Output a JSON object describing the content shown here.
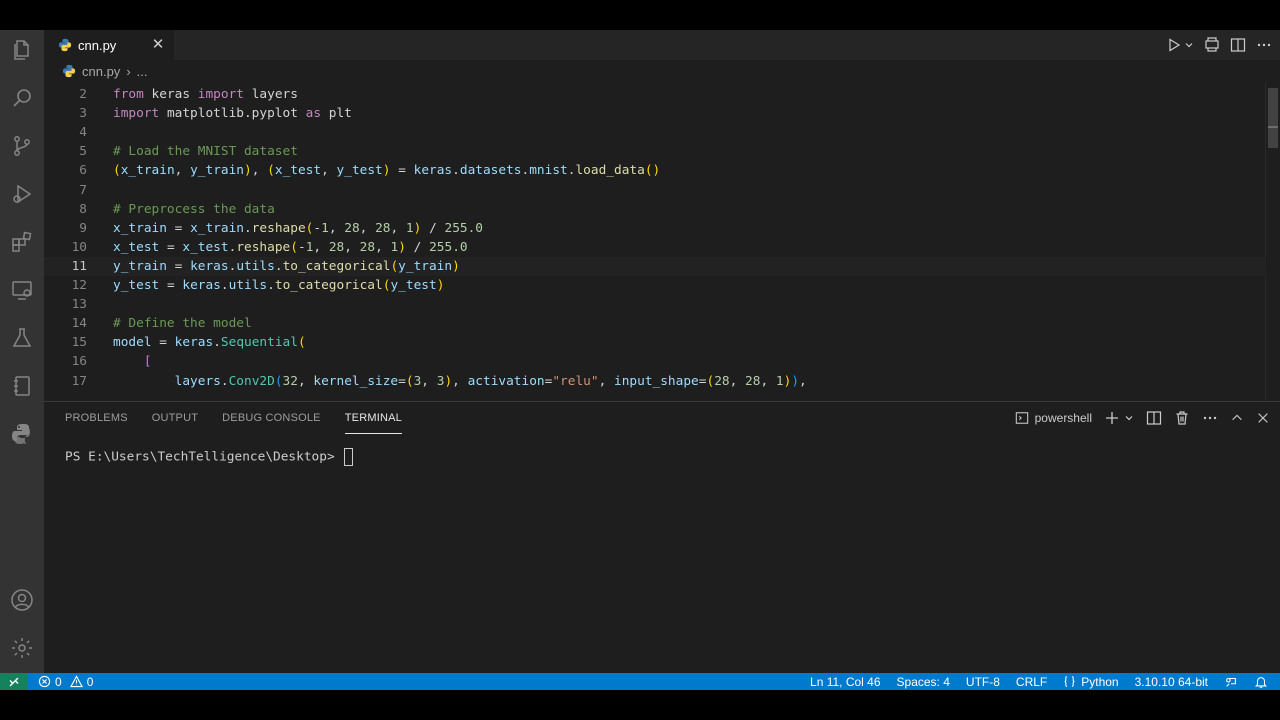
{
  "tabs": [
    {
      "label": "cnn.py"
    }
  ],
  "breadcrumb": {
    "file": "cnn.py",
    "more": "..."
  },
  "editor": {
    "lines": [
      {
        "n": "2",
        "tokens": [
          [
            "kw",
            "from "
          ],
          [
            "plain",
            "keras "
          ],
          [
            "kw",
            "import "
          ],
          [
            "plain",
            "layers"
          ]
        ]
      },
      {
        "n": "3",
        "tokens": [
          [
            "kw",
            "import "
          ],
          [
            "plain",
            "matplotlib.pyplot "
          ],
          [
            "kw",
            "as "
          ],
          [
            "plain",
            "plt"
          ]
        ]
      },
      {
        "n": "4",
        "tokens": []
      },
      {
        "n": "5",
        "tokens": [
          [
            "cm",
            "# Load the MNIST dataset"
          ]
        ]
      },
      {
        "n": "6",
        "tokens": [
          [
            "br1",
            "("
          ],
          [
            "var",
            "x_train"
          ],
          [
            "plain",
            ", "
          ],
          [
            "var",
            "y_train"
          ],
          [
            "br1",
            ")"
          ],
          [
            "plain",
            ", "
          ],
          [
            "br1",
            "("
          ],
          [
            "var",
            "x_test"
          ],
          [
            "plain",
            ", "
          ],
          [
            "var",
            "y_test"
          ],
          [
            "br1",
            ")"
          ],
          [
            "plain",
            " = "
          ],
          [
            "var",
            "keras"
          ],
          [
            "plain",
            "."
          ],
          [
            "var",
            "datasets"
          ],
          [
            "plain",
            "."
          ],
          [
            "var",
            "mnist"
          ],
          [
            "plain",
            "."
          ],
          [
            "fn",
            "load_data"
          ],
          [
            "br1",
            "()"
          ]
        ]
      },
      {
        "n": "7",
        "tokens": []
      },
      {
        "n": "8",
        "tokens": [
          [
            "cm",
            "# Preprocess the data"
          ]
        ]
      },
      {
        "n": "9",
        "tokens": [
          [
            "var",
            "x_train"
          ],
          [
            "plain",
            " = "
          ],
          [
            "var",
            "x_train"
          ],
          [
            "plain",
            "."
          ],
          [
            "fn",
            "reshape"
          ],
          [
            "br1",
            "("
          ],
          [
            "plain",
            "-"
          ],
          [
            "num",
            "1"
          ],
          [
            "plain",
            ", "
          ],
          [
            "num",
            "28"
          ],
          [
            "plain",
            ", "
          ],
          [
            "num",
            "28"
          ],
          [
            "plain",
            ", "
          ],
          [
            "num",
            "1"
          ],
          [
            "br1",
            ")"
          ],
          [
            "plain",
            " / "
          ],
          [
            "num",
            "255.0"
          ]
        ]
      },
      {
        "n": "10",
        "tokens": [
          [
            "var",
            "x_test"
          ],
          [
            "plain",
            " = "
          ],
          [
            "var",
            "x_test"
          ],
          [
            "plain",
            "."
          ],
          [
            "fn",
            "reshape"
          ],
          [
            "br1",
            "("
          ],
          [
            "plain",
            "-"
          ],
          [
            "num",
            "1"
          ],
          [
            "plain",
            ", "
          ],
          [
            "num",
            "28"
          ],
          [
            "plain",
            ", "
          ],
          [
            "num",
            "28"
          ],
          [
            "plain",
            ", "
          ],
          [
            "num",
            "1"
          ],
          [
            "br1",
            ")"
          ],
          [
            "plain",
            " / "
          ],
          [
            "num",
            "255.0"
          ]
        ]
      },
      {
        "n": "11",
        "tokens": [
          [
            "var",
            "y_train"
          ],
          [
            "plain",
            " = "
          ],
          [
            "var",
            "keras"
          ],
          [
            "plain",
            "."
          ],
          [
            "var",
            "utils"
          ],
          [
            "plain",
            "."
          ],
          [
            "fn",
            "to_categorical"
          ],
          [
            "br1",
            "("
          ],
          [
            "var",
            "y_train"
          ],
          [
            "br1",
            ")"
          ]
        ]
      },
      {
        "n": "12",
        "tokens": [
          [
            "var",
            "y_test"
          ],
          [
            "plain",
            " = "
          ],
          [
            "var",
            "keras"
          ],
          [
            "plain",
            "."
          ],
          [
            "var",
            "utils"
          ],
          [
            "plain",
            "."
          ],
          [
            "fn",
            "to_categorical"
          ],
          [
            "br1",
            "("
          ],
          [
            "var",
            "y_test"
          ],
          [
            "br1",
            ")"
          ]
        ]
      },
      {
        "n": "13",
        "tokens": []
      },
      {
        "n": "14",
        "tokens": [
          [
            "cm",
            "# Define the model"
          ]
        ]
      },
      {
        "n": "15",
        "tokens": [
          [
            "var",
            "model"
          ],
          [
            "plain",
            " = "
          ],
          [
            "var",
            "keras"
          ],
          [
            "plain",
            "."
          ],
          [
            "cls",
            "Sequential"
          ],
          [
            "br1",
            "("
          ]
        ]
      },
      {
        "n": "16",
        "tokens": [
          [
            "plain",
            "    "
          ],
          [
            "br2",
            "["
          ]
        ]
      },
      {
        "n": "17",
        "tokens": [
          [
            "plain",
            "        "
          ],
          [
            "var",
            "layers"
          ],
          [
            "plain",
            "."
          ],
          [
            "cls",
            "Conv2D"
          ],
          [
            "br3",
            "("
          ],
          [
            "num",
            "32"
          ],
          [
            "plain",
            ", "
          ],
          [
            "var",
            "kernel_size"
          ],
          [
            "plain",
            "="
          ],
          [
            "br1",
            "("
          ],
          [
            "num",
            "3"
          ],
          [
            "plain",
            ", "
          ],
          [
            "num",
            "3"
          ],
          [
            "br1",
            ")"
          ],
          [
            "plain",
            ", "
          ],
          [
            "var",
            "activation"
          ],
          [
            "plain",
            "="
          ],
          [
            "str",
            "\"relu\""
          ],
          [
            "plain",
            ", "
          ],
          [
            "var",
            "input_shape"
          ],
          [
            "plain",
            "="
          ],
          [
            "br1",
            "("
          ],
          [
            "num",
            "28"
          ],
          [
            "plain",
            ", "
          ],
          [
            "num",
            "28"
          ],
          [
            "plain",
            ", "
          ],
          [
            "num",
            "1"
          ],
          [
            "br1",
            ")"
          ],
          [
            "br3",
            ")"
          ],
          [
            "plain",
            ","
          ]
        ]
      }
    ]
  },
  "panel": {
    "tabs": [
      "PROBLEMS",
      "OUTPUT",
      "DEBUG CONSOLE",
      "TERMINAL"
    ],
    "active_tab": "TERMINAL",
    "shell": "powershell",
    "terminal_prompt": "PS E:\\Users\\TechTelligence\\Desktop> "
  },
  "statusbar": {
    "errors": "0",
    "warnings": "0",
    "position": "Ln 11, Col 46",
    "spaces": "Spaces: 4",
    "encoding": "UTF-8",
    "eol": "CRLF",
    "language": "Python",
    "interpreter": "3.10.10 64-bit"
  },
  "colors": {
    "accent": "#007acc",
    "remote": "#16825d",
    "editor_bg": "#1e1e1e",
    "activity_bg": "#333333"
  }
}
